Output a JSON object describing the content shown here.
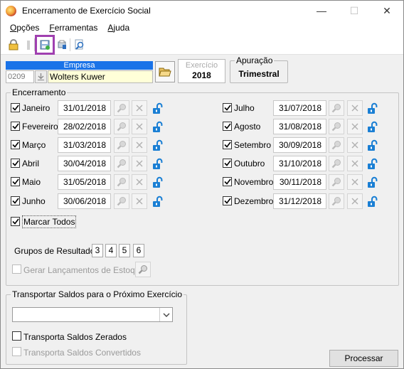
{
  "window": {
    "title": "Encerramento de Exercício Social"
  },
  "titlebar_buttons": {
    "minimize": "—",
    "maximize": "☐",
    "close": "✕"
  },
  "menu": [
    {
      "first": "O",
      "rest": "pções"
    },
    {
      "first": "F",
      "rest": "erramentas"
    },
    {
      "first": "A",
      "rest": "juda"
    }
  ],
  "empresa": {
    "label": "Empresa",
    "code": "0209",
    "name": "Wolters Kuwer"
  },
  "exercicio": {
    "label": "Exercício",
    "value": "2018"
  },
  "apuracao": {
    "label": "Apuração",
    "value": "Trimestral"
  },
  "encerramento": {
    "label": "Encerramento",
    "months_left": [
      {
        "name": "Janeiro",
        "date": "31/01/2018",
        "checked": true
      },
      {
        "name": "Fevereiro",
        "date": "28/02/2018",
        "checked": true
      },
      {
        "name": "Março",
        "date": "31/03/2018",
        "checked": true
      },
      {
        "name": "Abril",
        "date": "30/04/2018",
        "checked": true
      },
      {
        "name": "Maio",
        "date": "31/05/2018",
        "checked": true
      },
      {
        "name": "Junho",
        "date": "30/06/2018",
        "checked": true
      }
    ],
    "months_right": [
      {
        "name": "Julho",
        "date": "31/07/2018",
        "checked": true
      },
      {
        "name": "Agosto",
        "date": "31/08/2018",
        "checked": true
      },
      {
        "name": "Setembro",
        "date": "30/09/2018",
        "checked": true
      },
      {
        "name": "Outubro",
        "date": "31/10/2018",
        "checked": true
      },
      {
        "name": "Novembro",
        "date": "30/11/2018",
        "checked": true
      },
      {
        "name": "Dezembro",
        "date": "31/12/2018",
        "checked": true
      }
    ],
    "marcar_todos": "Marcar Todos",
    "grupos_label": "Grupos de Resultado:",
    "grupos": [
      "3",
      "4",
      "5",
      "6"
    ],
    "gerar_label": "Gerar Lançamentos de Estoque"
  },
  "transportar": {
    "label": "Transportar Saldos para o Próximo Exercício",
    "combo_value": "",
    "zerados_label": "Transporta Saldos Zerados",
    "convertidos_label": "Transporta Saldos Convertidos"
  },
  "processar_label": "Processar",
  "icons": {
    "lock_color": "#1a7fd4",
    "toolbar": [
      "lock-icon",
      "key-icon",
      "save-icon",
      "print-icon",
      "zoom-icon"
    ]
  }
}
